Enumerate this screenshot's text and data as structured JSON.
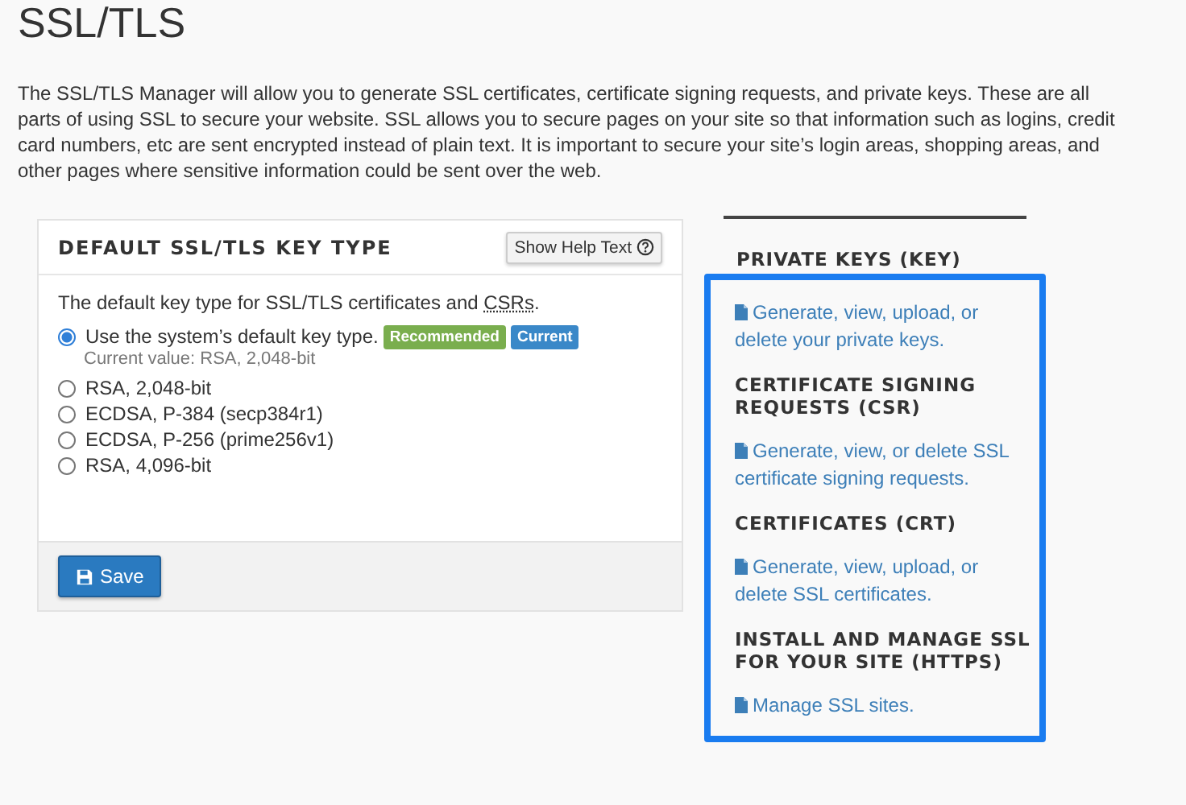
{
  "page_title": "SSL/TLS",
  "intro": "The SSL/TLS Manager will allow you to generate SSL certificates, certificate signing requests, and private keys. These are all parts of using SSL to secure your website. SSL allows you to secure pages on your site so that information such as logins, credit card numbers, etc are sent encrypted instead of plain text. It is important to secure your site’s login areas, shopping areas, and other pages where sensitive information could be sent over the web.",
  "key_type_panel": {
    "title": "DEFAULT SSL/TLS KEY TYPE",
    "help_button": "Show Help Text",
    "description": {
      "before": "The default key type for SSL/TLS certificates and ",
      "abbr": "CSRs",
      "after": "."
    },
    "options": [
      {
        "label": "Use the system’s default key type.",
        "selected": true,
        "badges": [
          {
            "text": "Recommended",
            "color": "#7aae4e"
          },
          {
            "text": "Current",
            "color": "#3a88c8"
          }
        ],
        "note": "Current value: RSA, 2,048-bit"
      },
      {
        "label": "RSA, 2,048-bit",
        "selected": false
      },
      {
        "label": "ECDSA, P-384 (secp384r1)",
        "selected": false
      },
      {
        "label": "ECDSA, P-256 (prime256v1)",
        "selected": false
      },
      {
        "label": "RSA, 4,096-bit",
        "selected": false
      }
    ],
    "save_button": "Save"
  },
  "sidebar": {
    "highlighted": true,
    "sections": [
      {
        "heading": "PRIVATE KEYS (KEY)",
        "link": "Generate, view, upload, or delete your private keys."
      },
      {
        "heading": "CERTIFICATE SIGNING REQUESTS (CSR)",
        "link": "Generate, view, or delete SSL certificate signing requests."
      },
      {
        "heading": "CERTIFICATES (CRT)",
        "link": "Generate, view, upload, or delete SSL certificates."
      },
      {
        "heading": "INSTALL AND MANAGE SSL FOR YOUR SITE (HTTPS)",
        "link": "Manage SSL sites."
      }
    ]
  }
}
